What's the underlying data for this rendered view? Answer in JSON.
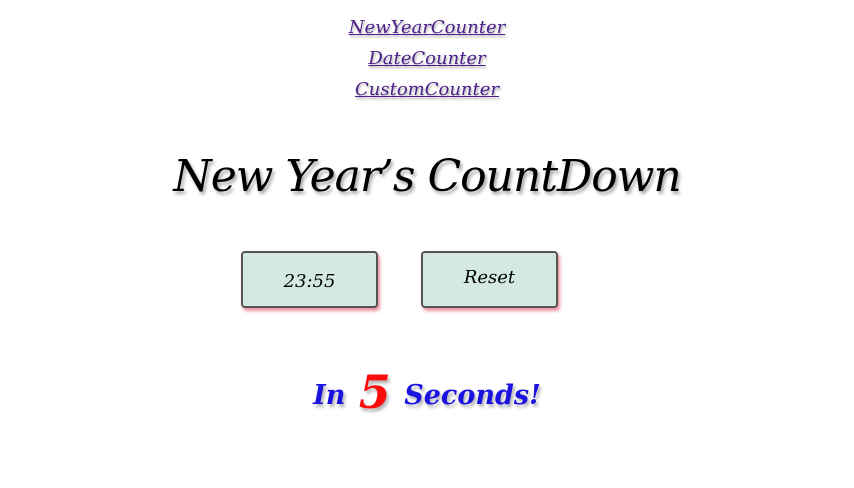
{
  "nav": {
    "links": [
      {
        "label": "NewYearCounter"
      },
      {
        "label": "DateCounter"
      },
      {
        "label": "CustomCounter"
      }
    ]
  },
  "title": "New Year’s CountDown",
  "buttons": {
    "time_label": "23:55",
    "reset_label": "Reset"
  },
  "status": {
    "prefix": "In",
    "count": "5",
    "suffix": "Seconds!"
  },
  "colors": {
    "link": "#4b1f8c",
    "button_bg": "#d3e9e2",
    "button_shadow": "#e66e82",
    "status_text": "#1a12e0",
    "status_count": "#ff0a0a"
  }
}
